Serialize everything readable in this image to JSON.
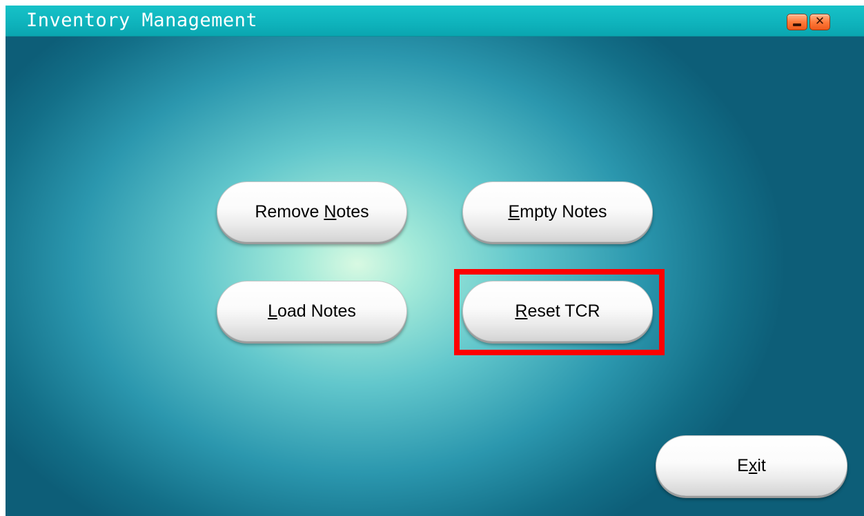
{
  "window": {
    "title": "Inventory Management",
    "minimize_icon": "minimize-icon",
    "close_icon": "close-icon",
    "close_glyph": "✕"
  },
  "buttons": {
    "remove_notes": {
      "before": "Remove ",
      "underlined": "N",
      "after": "otes"
    },
    "empty_notes": {
      "before": "",
      "underlined": "E",
      "after": "mpty Notes"
    },
    "load_notes": {
      "before": "",
      "underlined": "L",
      "after": "oad Notes"
    },
    "reset_tcr": {
      "before": "",
      "underlined": "R",
      "after": "eset TCR"
    },
    "exit": {
      "before": "E",
      "underlined": "x",
      "after": "it"
    }
  },
  "highlight": {
    "target": "reset_tcr",
    "color": "#ff0000"
  },
  "colors": {
    "titlebar": "#0fb4bd",
    "background_center": "#d8f9e2",
    "background_edge": "#0d5e78",
    "window_buttons": "#ff7a3a"
  }
}
